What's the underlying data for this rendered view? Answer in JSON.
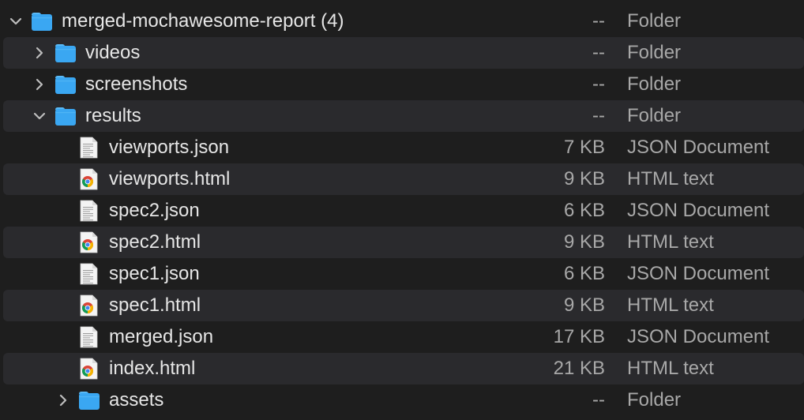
{
  "colors": {
    "background": "#1e1e1e",
    "alternate_row": "#2a2a2d",
    "name_text": "#e6e6e6",
    "secondary_text": "#a8a8a8",
    "folder_blue": "#3aa7f2",
    "folder_tab": "#59b9f6"
  },
  "rows": [
    {
      "name": "merged-mochawesome-report (4)",
      "size": "--",
      "kind": "Folder",
      "icon": "folder-icon",
      "disclosure": "expanded",
      "level": 0
    },
    {
      "name": "videos",
      "size": "--",
      "kind": "Folder",
      "icon": "folder-icon",
      "disclosure": "collapsed",
      "level": 1
    },
    {
      "name": "screenshots",
      "size": "--",
      "kind": "Folder",
      "icon": "folder-icon",
      "disclosure": "collapsed",
      "level": 1
    },
    {
      "name": "results",
      "size": "--",
      "kind": "Folder",
      "icon": "folder-icon",
      "disclosure": "expanded",
      "level": 1
    },
    {
      "name": "viewports.json",
      "size": "7 KB",
      "kind": "JSON Document",
      "icon": "json-document-icon",
      "disclosure": "none",
      "level": 2
    },
    {
      "name": "viewports.html",
      "size": "9 KB",
      "kind": "HTML text",
      "icon": "chrome-html-document-icon",
      "disclosure": "none",
      "level": 2
    },
    {
      "name": "spec2.json",
      "size": "6 KB",
      "kind": "JSON Document",
      "icon": "json-document-icon",
      "disclosure": "none",
      "level": 2
    },
    {
      "name": "spec2.html",
      "size": "9 KB",
      "kind": "HTML text",
      "icon": "chrome-html-document-icon",
      "disclosure": "none",
      "level": 2
    },
    {
      "name": "spec1.json",
      "size": "6 KB",
      "kind": "JSON Document",
      "icon": "json-document-icon",
      "disclosure": "none",
      "level": 2
    },
    {
      "name": "spec1.html",
      "size": "9 KB",
      "kind": "HTML text",
      "icon": "chrome-html-document-icon",
      "disclosure": "none",
      "level": 2
    },
    {
      "name": "merged.json",
      "size": "17 KB",
      "kind": "JSON Document",
      "icon": "json-document-icon",
      "disclosure": "none",
      "level": 2
    },
    {
      "name": "index.html",
      "size": "21 KB",
      "kind": "HTML text",
      "icon": "chrome-html-document-icon",
      "disclosure": "none",
      "level": 2
    },
    {
      "name": "assets",
      "size": "--",
      "kind": "Folder",
      "icon": "folder-icon",
      "disclosure": "collapsed",
      "level": 2
    }
  ]
}
